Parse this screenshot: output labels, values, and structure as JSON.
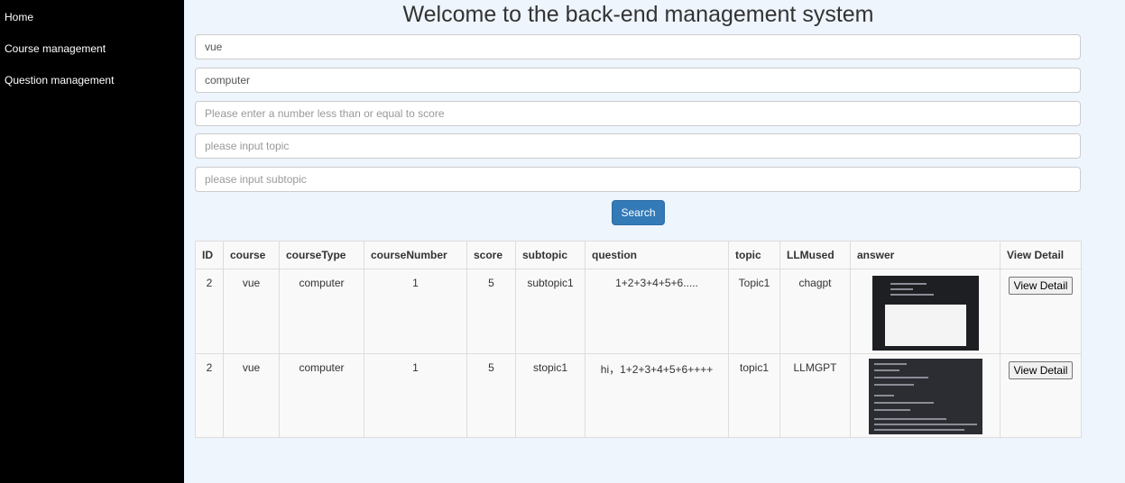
{
  "sidebar": {
    "items": [
      {
        "label": "Home"
      },
      {
        "label": "Course management"
      },
      {
        "label": "Question management"
      }
    ]
  },
  "header": {
    "title": "Welcome to the back-end management system"
  },
  "filters": {
    "course": {
      "value": "vue",
      "placeholder": ""
    },
    "course_type": {
      "value": "computer",
      "placeholder": ""
    },
    "score": {
      "value": "",
      "placeholder": "Please enter a number less than or equal to score"
    },
    "topic": {
      "value": "",
      "placeholder": "please input topic"
    },
    "subtopic": {
      "value": "",
      "placeholder": "please input subtopic"
    },
    "search_label": "Search"
  },
  "table": {
    "headers": [
      "ID",
      "course",
      "courseType",
      "courseNumber",
      "score",
      "subtopic",
      "question",
      "topic",
      "LLMused",
      "answer",
      "View Detail"
    ],
    "rows": [
      {
        "id": "2",
        "course": "vue",
        "courseType": "computer",
        "courseNumber": "1",
        "score": "5",
        "subtopic": "subtopic1",
        "question": "1+2+3+4+5+6.....",
        "topic": "Topic1",
        "llm": "chagpt",
        "answer_icon": "screenshot-thumbnail",
        "detail_label": "View Detail"
      },
      {
        "id": "2",
        "course": "vue",
        "courseType": "computer",
        "courseNumber": "1",
        "score": "5",
        "subtopic": "stopic1",
        "question": "hi，1+2+3+4+5+6++++",
        "topic": "topic1",
        "llm": "LLMGPT",
        "answer_icon": "screenshot-thumbnail",
        "detail_label": "View Detail"
      }
    ]
  },
  "colors": {
    "sidebar_bg": "#000000",
    "page_bg": "#eef5fd",
    "primary_button": "#337ab7"
  }
}
